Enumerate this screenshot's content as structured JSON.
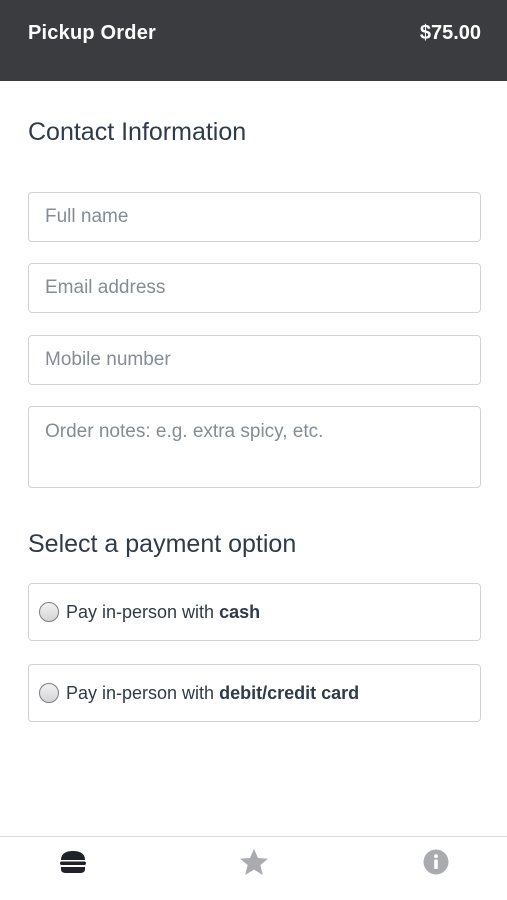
{
  "header": {
    "title": "Pickup Order",
    "total": "$75.00",
    "background": "#3a3c40"
  },
  "contact": {
    "heading": "Contact Information",
    "full_name_placeholder": "Full name",
    "email_placeholder": "Email address",
    "mobile_placeholder": "Mobile number",
    "notes_placeholder": "Order notes: e.g. extra spicy, etc."
  },
  "payment": {
    "heading": "Select a payment option",
    "options": [
      {
        "prefix": "Pay in-person with",
        "method": "cash",
        "selected": false
      },
      {
        "prefix": "Pay in-person with",
        "method": "debit/credit card",
        "selected": false
      }
    ]
  },
  "bottom_nav": {
    "items": [
      {
        "icon": "burger-icon",
        "active": true
      },
      {
        "icon": "star-icon",
        "active": false
      },
      {
        "icon": "info-icon",
        "active": false
      }
    ],
    "active_color": "#1f2329",
    "inactive_color": "#a9abae"
  }
}
